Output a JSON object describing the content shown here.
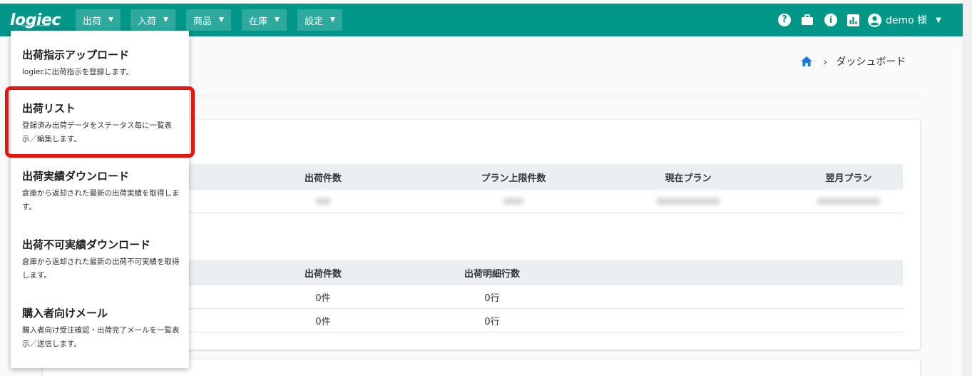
{
  "brand": {
    "logo": "logiec"
  },
  "nav": {
    "items": [
      {
        "label": "出荷"
      },
      {
        "label": "入荷"
      },
      {
        "label": "商品"
      },
      {
        "label": "在庫"
      },
      {
        "label": "設定"
      }
    ]
  },
  "user": {
    "name": "demo 様"
  },
  "breadcrumb": {
    "current": "ダッシュボード"
  },
  "menu": {
    "items": [
      {
        "title": "出荷指示アップロード",
        "desc": "logiecに出荷指示を登録します。"
      },
      {
        "title": "出荷リスト",
        "desc": "登録済み出荷データをステータス毎に一覧表示／編集します。"
      },
      {
        "title": "出荷実績ダウンロード",
        "desc": "倉庫から返却された最新の出荷実績を取得します。"
      },
      {
        "title": "出荷不可実績ダウンロード",
        "desc": "倉庫から返却された最新の出荷不可実績を取得します。"
      },
      {
        "title": "購入者向けメール",
        "desc": "購入者向け受注確認・出荷完了メールを一覧表示／送信します。"
      }
    ]
  },
  "table1": {
    "headers": [
      "出荷件数",
      "プラン上限件数",
      "現在プラン",
      "翌月プラン"
    ]
  },
  "table2": {
    "headers": [
      "出荷件数",
      "出荷明細行数"
    ],
    "rows": [
      [
        "0件",
        "0行"
      ],
      [
        "0件",
        "0行"
      ]
    ]
  },
  "colors": {
    "header": "#009688",
    "highlight": "#e8140e",
    "home_icon": "#1976d2"
  }
}
